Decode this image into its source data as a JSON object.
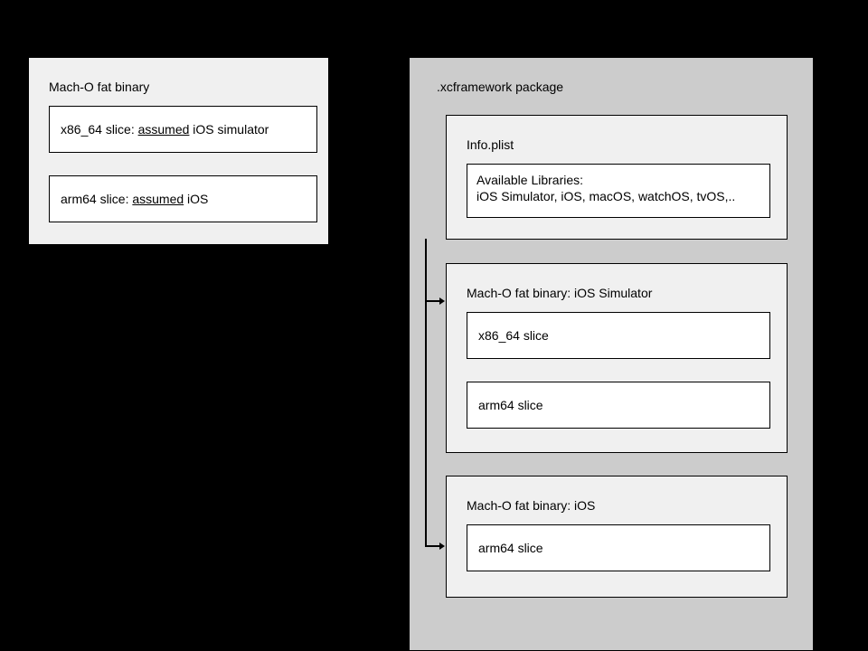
{
  "left": {
    "title": "Mach-O fat binary",
    "slice1_pre": "x86_64 slice: ",
    "slice1_u": "assumed",
    "slice1_post": " iOS simulator",
    "slice2_pre": "arm64 slice: ",
    "slice2_u": "assumed",
    "slice2_post": " iOS"
  },
  "right": {
    "title": ".xcframework package",
    "info_title": "Info.plist",
    "info_body_l1": "Available Libraries:",
    "info_body_l2": "iOS Simulator, iOS, macOS, watchOS, tvOS,..",
    "sim_title": "Mach-O fat binary: iOS Simulator",
    "sim_slice1": "x86_64 slice",
    "sim_slice2": "arm64 slice",
    "ios_title": "Mach-O fat binary: iOS",
    "ios_slice1": "arm64 slice"
  }
}
